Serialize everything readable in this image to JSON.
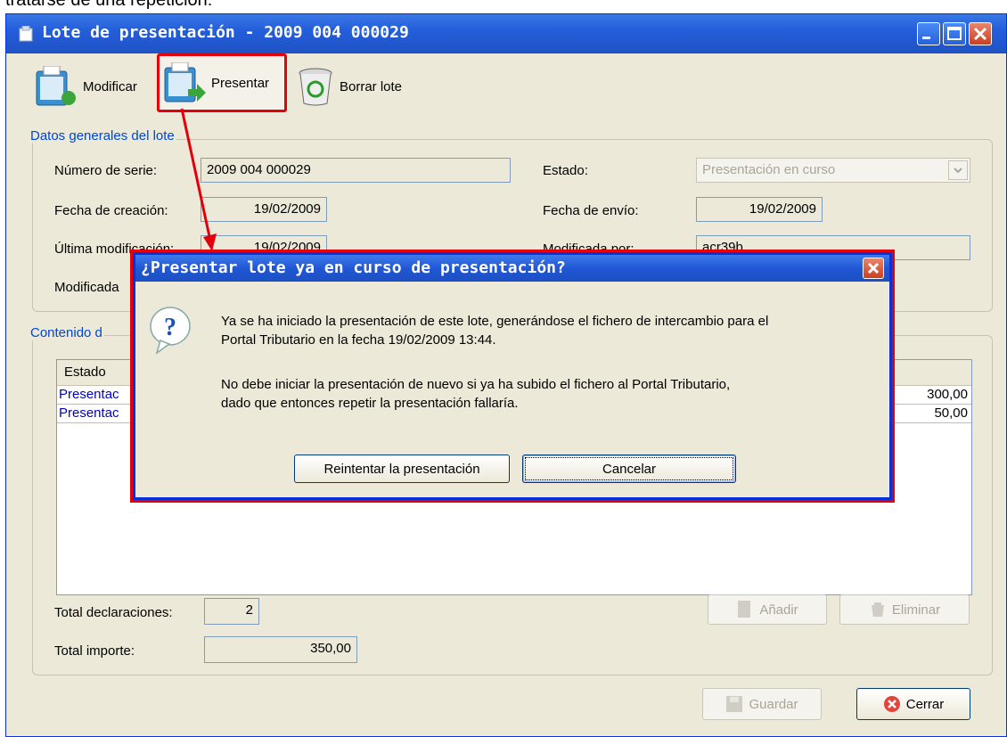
{
  "caption": "tratarse de una repetición:",
  "window": {
    "title": "Lote de presentación  - 2009 004 000029"
  },
  "toolbar": {
    "modificar": "Modificar",
    "presentar": "Presentar",
    "borrar": "Borrar lote"
  },
  "general": {
    "title": "Datos generales del lote",
    "serie_label": "Número de serie:",
    "serie_value": "2009 004 000029",
    "creacion_label": "Fecha de creación:",
    "creacion_value": "19/02/2009",
    "ultima_label": "Última modificación:",
    "ultima_value": "19/02/2009",
    "modificada_label": "Modificada",
    "estado_label": "Estado:",
    "estado_value": "Presentación en curso",
    "envio_label": "Fecha de envío:",
    "envio_value": "19/02/2009",
    "modificada_por_label": "Modificada por:",
    "modificada_por_value": "acr39b"
  },
  "contenido": {
    "title": "Contenido d",
    "col_estado": "Estado",
    "rows": [
      {
        "estado": "Presentac",
        "importe": "300,00"
      },
      {
        "estado": "Presentac",
        "importe": "50,00"
      }
    ],
    "total_decl_label": "Total declaraciones:",
    "total_decl_value": "2",
    "total_imp_label": "Total importe:",
    "total_imp_value": "350,00",
    "anadir": "Añadir",
    "eliminar": "Eliminar"
  },
  "footer": {
    "guardar": "Guardar",
    "cerrar": "Cerrar"
  },
  "dialog": {
    "title": "¿Presentar lote ya en curso de presentación?",
    "line1": "Ya se ha iniciado la presentación de este lote, generándose el fichero de intercambio para el",
    "line2": "Portal Tributario en la fecha 19/02/2009 13:44.",
    "line3": "No debe iniciar la presentación de nuevo si ya ha subido el fichero al Portal Tributario,",
    "line4": "dado que entonces repetir la presentación fallaría.",
    "retry": "Reintentar la presentación",
    "cancel": "Cancelar"
  },
  "colors": {
    "titlebar": "#245edb",
    "annotation": "#e3000b",
    "group_title": "#0046d5"
  }
}
